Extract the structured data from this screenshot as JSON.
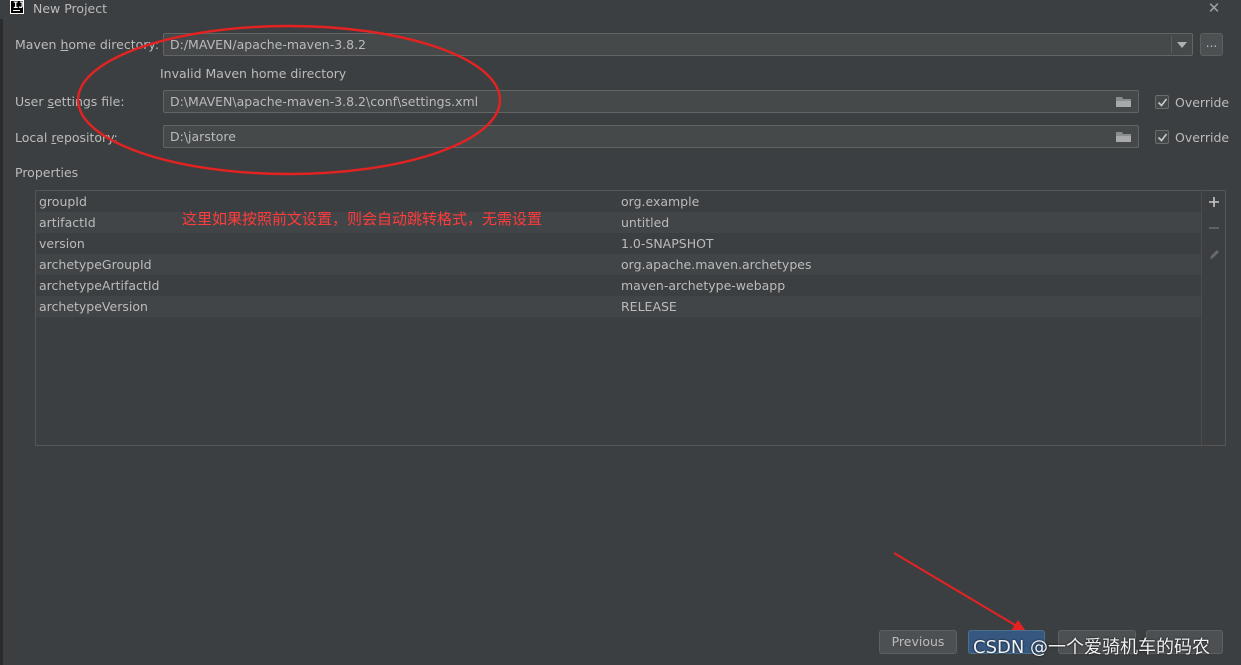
{
  "window": {
    "title": "New Project",
    "app_icon": "intellij-icon",
    "close_icon": "close-icon"
  },
  "maven_home": {
    "label_prefix": "Maven ",
    "label_mnemonic": "h",
    "label_suffix": "ome directory:",
    "value": "D:/MAVEN/apache-maven-3.8.2",
    "browse_label": "...",
    "error": "Invalid Maven home directory"
  },
  "user_settings": {
    "label_prefix": "User ",
    "label_mnemonic": "s",
    "label_suffix": "ettings file:",
    "value": "D:\\MAVEN\\apache-maven-3.8.2\\conf\\settings.xml",
    "override_label": "Override",
    "override_checked": true
  },
  "local_repo": {
    "label_prefix": "Local ",
    "label_mnemonic": "r",
    "label_suffix": "epository:",
    "value": "D:\\jarstore",
    "override_label": "Override",
    "override_checked": true
  },
  "properties": {
    "title": "Properties",
    "rows": [
      {
        "key": "groupId",
        "value": "org.example"
      },
      {
        "key": "artifactId",
        "value": "untitled"
      },
      {
        "key": "version",
        "value": "1.0-SNAPSHOT"
      },
      {
        "key": "archetypeGroupId",
        "value": "org.apache.maven.archetypes"
      },
      {
        "key": "archetypeArtifactId",
        "value": "maven-archetype-webapp"
      },
      {
        "key": "archetypeVersion",
        "value": "RELEASE"
      }
    ]
  },
  "annotation": {
    "text": "这里如果按照前文设置，则会自动跳转格式，无需设置",
    "color": "#ff3b3b"
  },
  "buttons": {
    "previous": "Previous",
    "next": "",
    "finish": "",
    "cancel": ""
  },
  "watermark": "CSDN @一个爱骑机车的码农",
  "colors": {
    "background": "#3c3f41",
    "field_bg": "#45494a",
    "primary_button": "#365880",
    "annotation_red": "#ff2a2a"
  }
}
